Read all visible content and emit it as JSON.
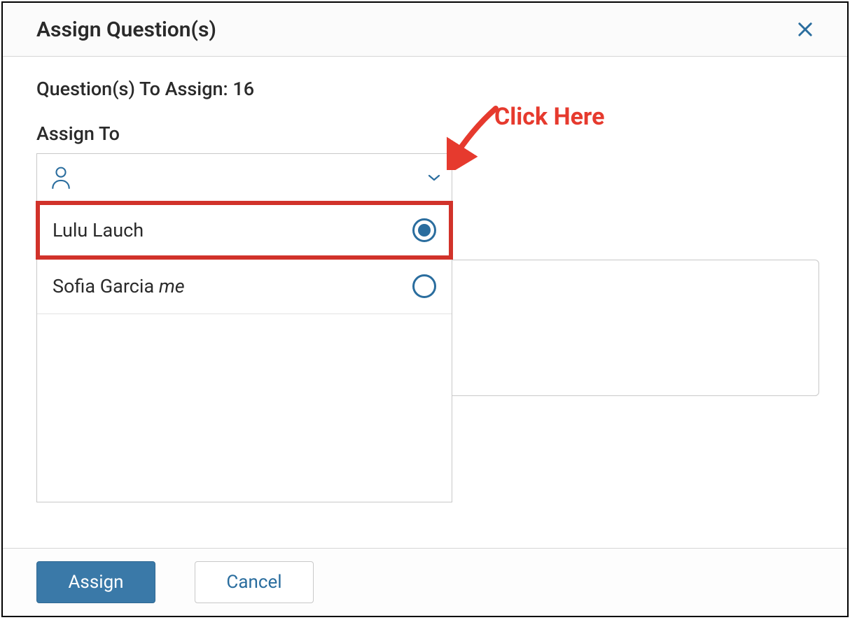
{
  "modal": {
    "title": "Assign Question(s)",
    "close_icon": "close"
  },
  "body": {
    "questions_label": "Question(s) To Assign: 16",
    "assign_to_label": "Assign To",
    "dropdown": {
      "options": [
        {
          "name": "Lulu Lauch",
          "suffix": "",
          "selected": true
        },
        {
          "name": "Sofia Garcia ",
          "suffix": "me",
          "selected": false
        }
      ]
    }
  },
  "annotation": {
    "text": "Click Here"
  },
  "footer": {
    "assign_label": "Assign",
    "cancel_label": "Cancel"
  }
}
